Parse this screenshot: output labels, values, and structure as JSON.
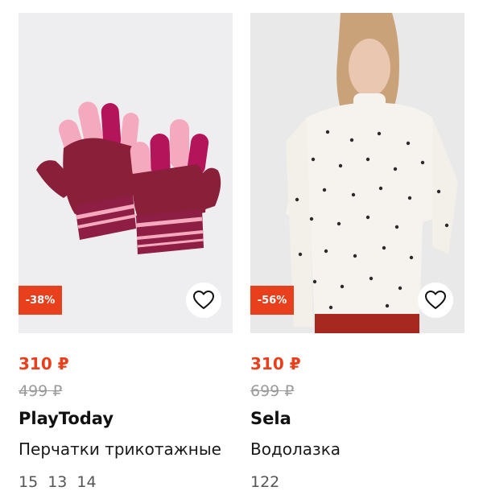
{
  "products": [
    {
      "discount": "-38%",
      "price_now": "310 ₽",
      "price_old": "499 ₽",
      "brand": "PlayToday",
      "title": "Перчатки трикотажные",
      "sizes": [
        "15",
        "13",
        "14"
      ],
      "icon": "heart-outline"
    },
    {
      "discount": "-56%",
      "price_now": "310 ₽",
      "price_old": "699 ₽",
      "brand": "Sela",
      "title": "Водолазка",
      "sizes": [
        "122"
      ],
      "icon": "heart-outline"
    }
  ],
  "colors": {
    "accent": "#e8401c",
    "old_price": "#9a9a9a"
  }
}
